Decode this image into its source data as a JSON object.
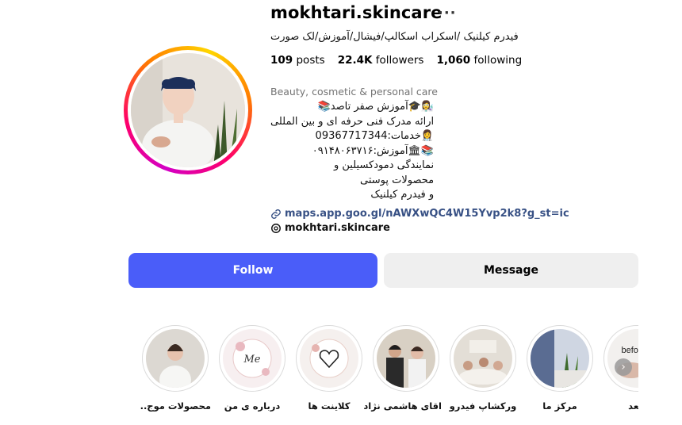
{
  "profile": {
    "username": "mokhtari.skincare",
    "more_glyph": "···",
    "full_name": "فیدرم کیلنیک /اسکراب اسکالپ/فیشال/آموزش/لک صورت",
    "stats": {
      "posts_count": "109",
      "posts_label": "posts",
      "followers_count": "22.4K",
      "followers_label": "followers",
      "following_count": "1,060",
      "following_label": "following"
    },
    "category": "Beauty, cosmetic & personal care",
    "bio_lines": [
      "👩‍🔬🎓آموزش صفر تاصد📚",
      "ارائه مدرک فنی حرفه ای و بین المللی",
      "👩‍⚕️خدمات:09367717344",
      "📚🏛آموزش:۰۹۱۴۸۰۶۳۷۱۶",
      "نمایندگی دمودکسیلین و",
      "محصولات پوستی",
      "و فیدرم کیلنیک"
    ],
    "link": "maps.app.goo.gl/nAWXwQC4W15Yvp2k8?g_st=ic",
    "threads_handle": "mokhtari.skincare"
  },
  "actions": {
    "follow_label": "Follow",
    "message_label": "Message"
  },
  "highlights": [
    {
      "label": "محصولات موج..."
    },
    {
      "label": "درباره ی من",
      "cover_text": "Me"
    },
    {
      "label": "کلاینت ها"
    },
    {
      "label": "اقای هاشمی نژاد"
    },
    {
      "label": "ورکشاپ فیدرو"
    },
    {
      "label": "مرکز ما"
    },
    {
      "label": "/بعد",
      "cover_text": "befor"
    }
  ],
  "colors": {
    "accent": "#4a5df9",
    "link": "#385185",
    "muted": "#737373",
    "button_grey": "#efefef"
  }
}
